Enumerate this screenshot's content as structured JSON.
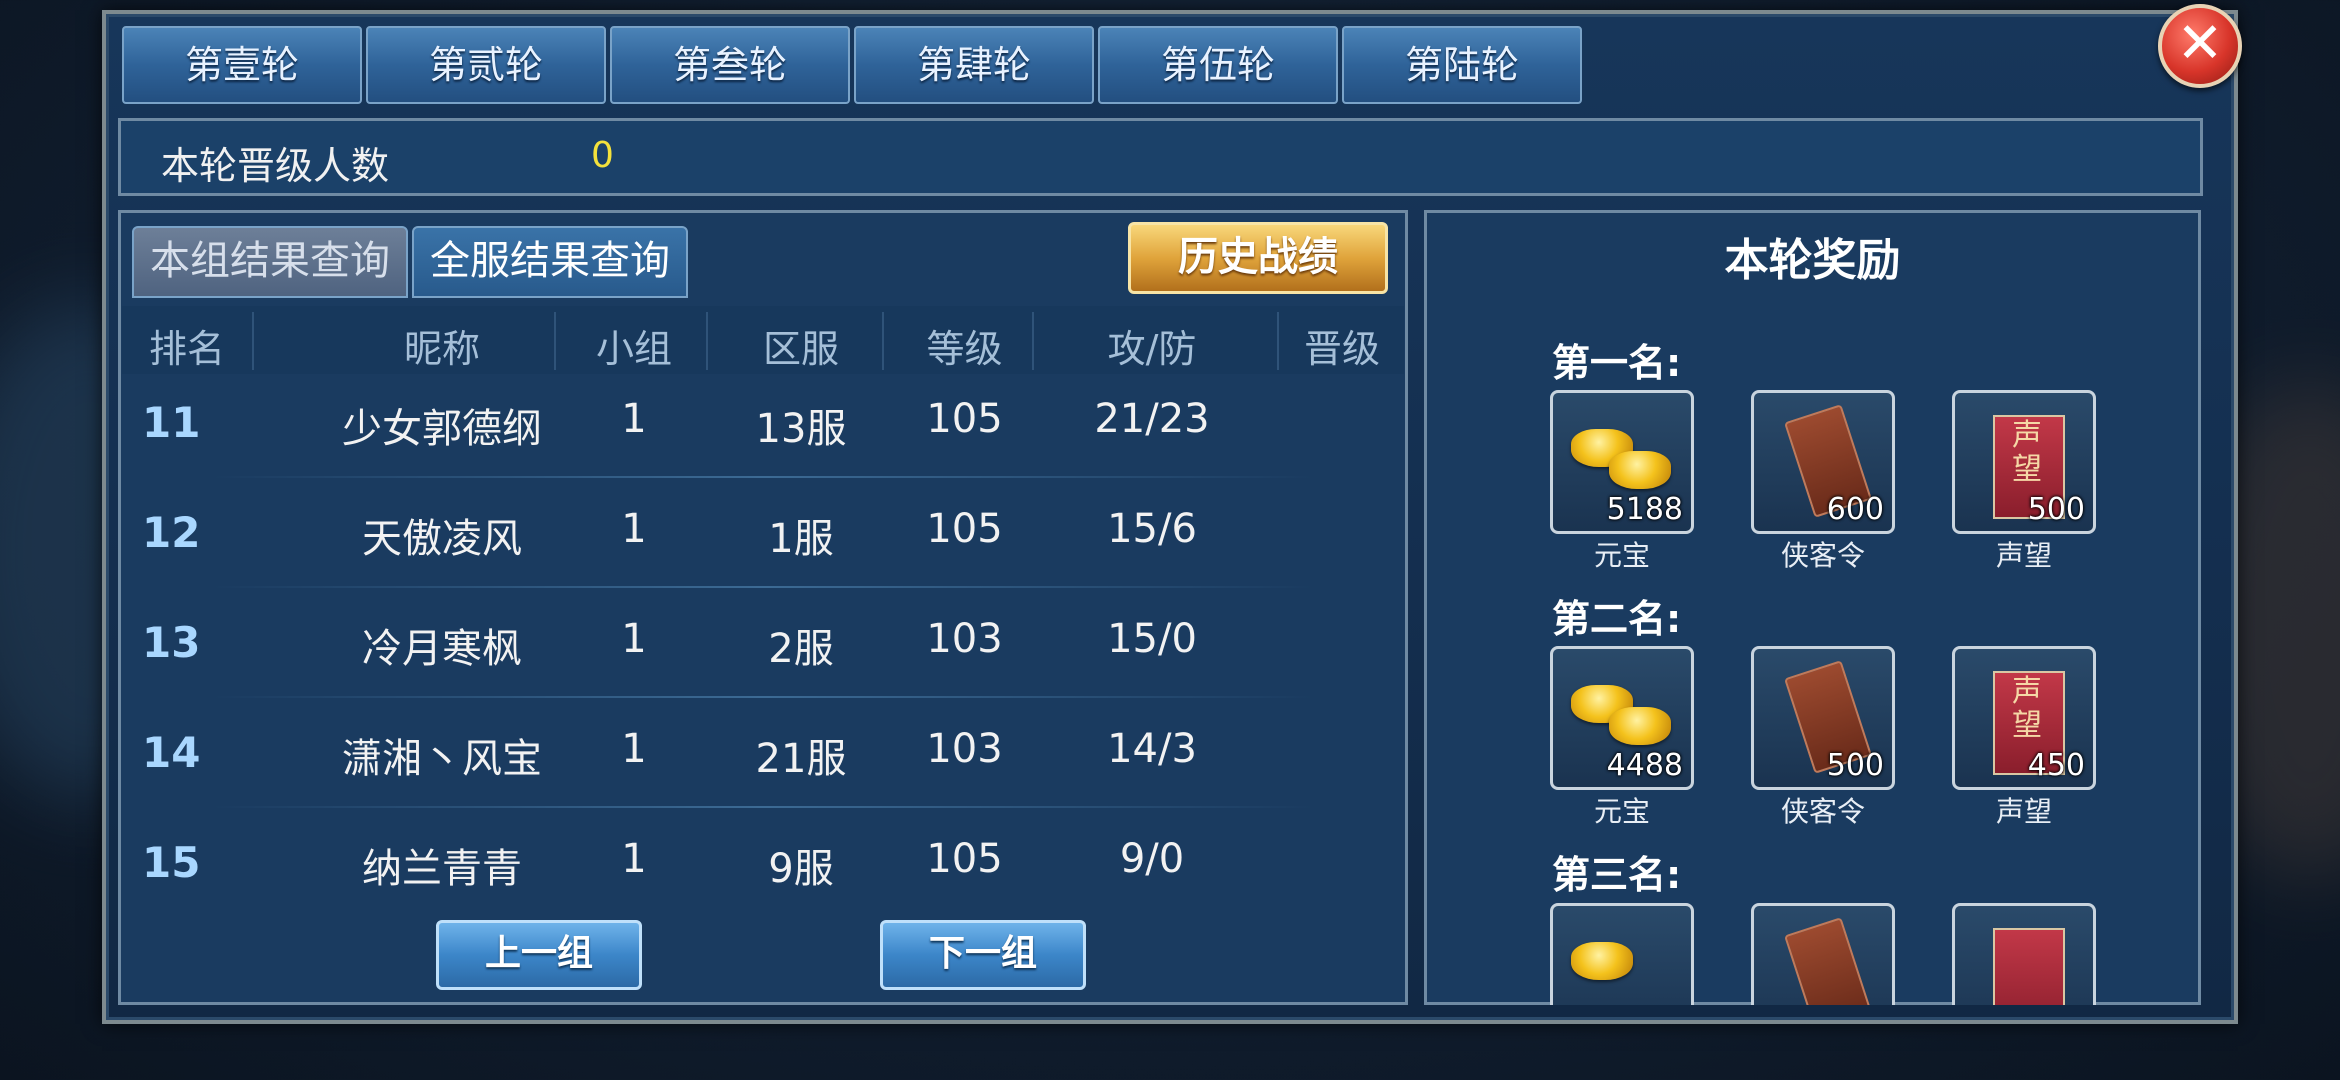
{
  "round_tabs": [
    "第壹轮",
    "第贰轮",
    "第叁轮",
    "第肆轮",
    "第伍轮",
    "第陆轮"
  ],
  "close_label": "✕",
  "advance": {
    "label": "本轮晋级人数",
    "value": "0"
  },
  "subtabs": {
    "group": "本组结果查询",
    "server": "全服结果查询"
  },
  "history_button": "历史战绩",
  "table": {
    "headers": [
      "排名",
      "昵称",
      "小组",
      "区服",
      "等级",
      "攻/防",
      "晋级"
    ],
    "rows": [
      {
        "rank": "11",
        "name": "少女郭德纲",
        "group": "1",
        "server": "13服",
        "level": "105",
        "atkdef": "21/23"
      },
      {
        "rank": "12",
        "name": "天傲凌风",
        "group": "1",
        "server": "1服",
        "level": "105",
        "atkdef": "15/6"
      },
      {
        "rank": "13",
        "name": "冷月寒枫",
        "group": "1",
        "server": "2服",
        "level": "103",
        "atkdef": "15/0"
      },
      {
        "rank": "14",
        "name": "潇湘丶风宝",
        "group": "1",
        "server": "21服",
        "level": "103",
        "atkdef": "14/3"
      },
      {
        "rank": "15",
        "name": "纳兰青青",
        "group": "1",
        "server": "9服",
        "level": "105",
        "atkdef": "9/0"
      }
    ]
  },
  "nav": {
    "prev": "上一组",
    "next": "下一组"
  },
  "rewards": {
    "title": "本轮奖励",
    "tiers": [
      {
        "label": "第一名:",
        "items": [
          {
            "name": "元宝",
            "count": "5188",
            "icon": "gold-ingot-icon"
          },
          {
            "name": "侠客令",
            "count": "600",
            "icon": "token-icon"
          },
          {
            "name": "声望",
            "count": "500",
            "icon": "banner-icon"
          }
        ]
      },
      {
        "label": "第二名:",
        "items": [
          {
            "name": "元宝",
            "count": "4488",
            "icon": "gold-ingot-icon"
          },
          {
            "name": "侠客令",
            "count": "500",
            "icon": "token-icon"
          },
          {
            "name": "声望",
            "count": "450",
            "icon": "banner-icon"
          }
        ]
      },
      {
        "label": "第三名:"
      }
    ],
    "banner_text": "声望"
  }
}
